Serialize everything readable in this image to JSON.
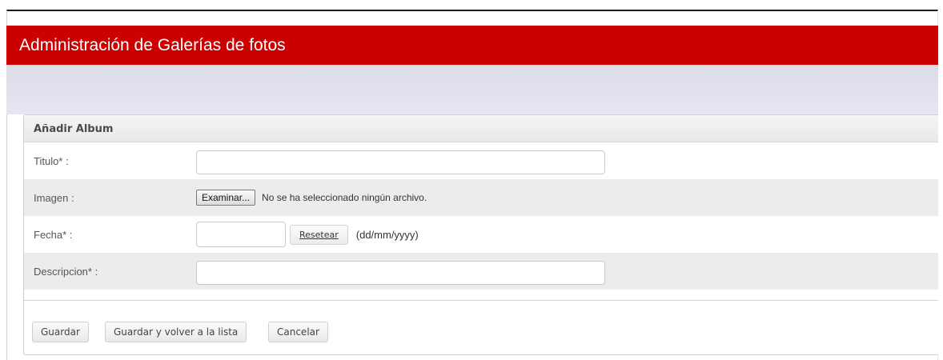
{
  "page": {
    "title": "Administración de Galerías de fotos"
  },
  "panel": {
    "header": "Añadir Album"
  },
  "form": {
    "titulo": {
      "label": "Titulo* :",
      "value": ""
    },
    "imagen": {
      "label": "Imagen :",
      "button_label": "Examinar...",
      "status": "No se ha seleccionado ningún archivo."
    },
    "fecha": {
      "label": "Fecha* :",
      "value": "",
      "reset_label": "Resetear",
      "format_hint": "(dd/mm/yyyy)"
    },
    "descripcion": {
      "label": "Descripcion* :",
      "value": ""
    }
  },
  "actions": {
    "save_label": "Guardar",
    "save_return_label": "Guardar y volver a la lista",
    "cancel_label": "Cancelar"
  },
  "colors": {
    "header_red": "#cc0000",
    "toolbar_band": "#dcdbe8",
    "alt_row": "#ececec"
  }
}
